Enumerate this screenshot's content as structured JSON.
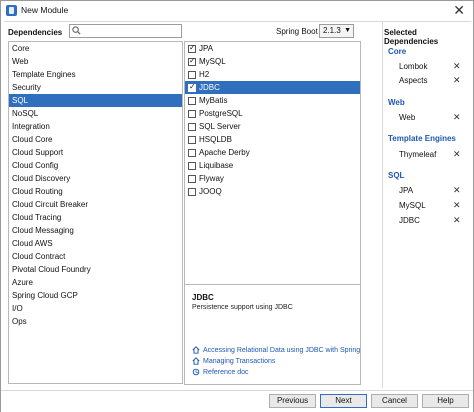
{
  "window": {
    "title": "New Module"
  },
  "dependencies": {
    "label": "Dependencies",
    "search_placeholder": "",
    "categories": [
      "Core",
      "Web",
      "Template Engines",
      "Security",
      "SQL",
      "NoSQL",
      "Integration",
      "Cloud Core",
      "Cloud Support",
      "Cloud Config",
      "Cloud Discovery",
      "Cloud Routing",
      "Cloud Circuit Breaker",
      "Cloud Tracing",
      "Cloud Messaging",
      "Cloud AWS",
      "Cloud Contract",
      "Pivotal Cloud Foundry",
      "Azure",
      "Spring Cloud GCP",
      "I/O",
      "Ops"
    ],
    "selected_category": "SQL"
  },
  "spring_boot": {
    "label": "Spring Boot",
    "version": "2.1.3"
  },
  "dep_items": [
    {
      "label": "JPA",
      "checked": true,
      "selected": false
    },
    {
      "label": "MySQL",
      "checked": true,
      "selected": false
    },
    {
      "label": "H2",
      "checked": false,
      "selected": false
    },
    {
      "label": "JDBC",
      "checked": true,
      "selected": true
    },
    {
      "label": "MyBatis",
      "checked": false,
      "selected": false
    },
    {
      "label": "PostgreSQL",
      "checked": false,
      "selected": false
    },
    {
      "label": "SQL Server",
      "checked": false,
      "selected": false
    },
    {
      "label": "HSQLDB",
      "checked": false,
      "selected": false
    },
    {
      "label": "Apache Derby",
      "checked": false,
      "selected": false
    },
    {
      "label": "Liquibase",
      "checked": false,
      "selected": false
    },
    {
      "label": "Flyway",
      "checked": false,
      "selected": false
    },
    {
      "label": "JOOQ",
      "checked": false,
      "selected": false
    }
  ],
  "description": {
    "title": "JDBC",
    "text": "Persistence support using JDBC",
    "links": [
      "Accessing Relational Data using JDBC with Spring",
      "Managing Transactions",
      "Reference doc"
    ]
  },
  "selected_deps": {
    "title": "Selected Dependencies",
    "groups": [
      {
        "name": "Core",
        "items": [
          "Lombok",
          "Aspects"
        ]
      },
      {
        "name": "Web",
        "items": [
          "Web"
        ]
      },
      {
        "name": "Template Engines",
        "items": [
          "Thymeleaf"
        ]
      },
      {
        "name": "SQL",
        "items": [
          "JPA",
          "MySQL",
          "JDBC"
        ]
      }
    ]
  },
  "buttons": {
    "previous": "Previous",
    "next": "Next",
    "cancel": "Cancel",
    "help": "Help"
  },
  "colors": {
    "selection": "#2f6fbd",
    "link": "#1f57b5"
  }
}
